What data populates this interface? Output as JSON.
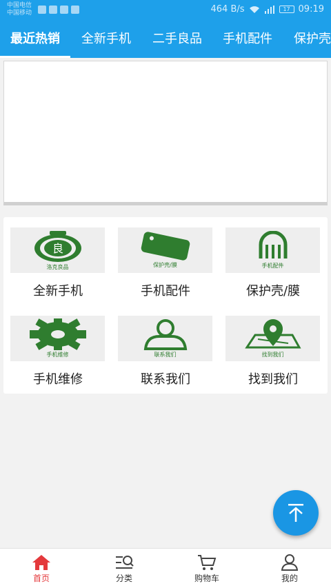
{
  "status_bar": {
    "carrier_1": "中国电信",
    "carrier_2": "中国移动",
    "speed": "464 B/s",
    "battery": "17",
    "time": "09:19"
  },
  "tabs": [
    "最近热销",
    "全新手机",
    "二手良品",
    "手机配件",
    "保护壳"
  ],
  "grid": [
    {
      "label": "全新手机",
      "caption": "洛克良品",
      "icon": "liang-badge-icon"
    },
    {
      "label": "手机配件",
      "caption": "保护壳/膜",
      "icon": "phone-case-icon"
    },
    {
      "label": "保护壳/膜",
      "caption": "手机配件",
      "icon": "accessory-icon"
    },
    {
      "label": "手机维修",
      "caption": "手机维修",
      "icon": "gear-icon"
    },
    {
      "label": "联系我们",
      "caption": "联系我们",
      "icon": "person-icon"
    },
    {
      "label": "找到我们",
      "caption": "找到我们",
      "icon": "map-pin-icon"
    }
  ],
  "bottom_nav": [
    {
      "label": "首页",
      "icon": "home-icon",
      "active": true
    },
    {
      "label": "分类",
      "icon": "category-search-icon",
      "active": false
    },
    {
      "label": "购物车",
      "icon": "cart-icon",
      "active": false
    },
    {
      "label": "我的",
      "icon": "user-icon",
      "active": false
    }
  ],
  "colors": {
    "primary": "#1ea0ea",
    "accent": "#e4393c",
    "icon_green": "#2f7d2f",
    "fab": "#1a96e4"
  },
  "fab": {
    "icon": "arrow-up-to-top-icon"
  }
}
